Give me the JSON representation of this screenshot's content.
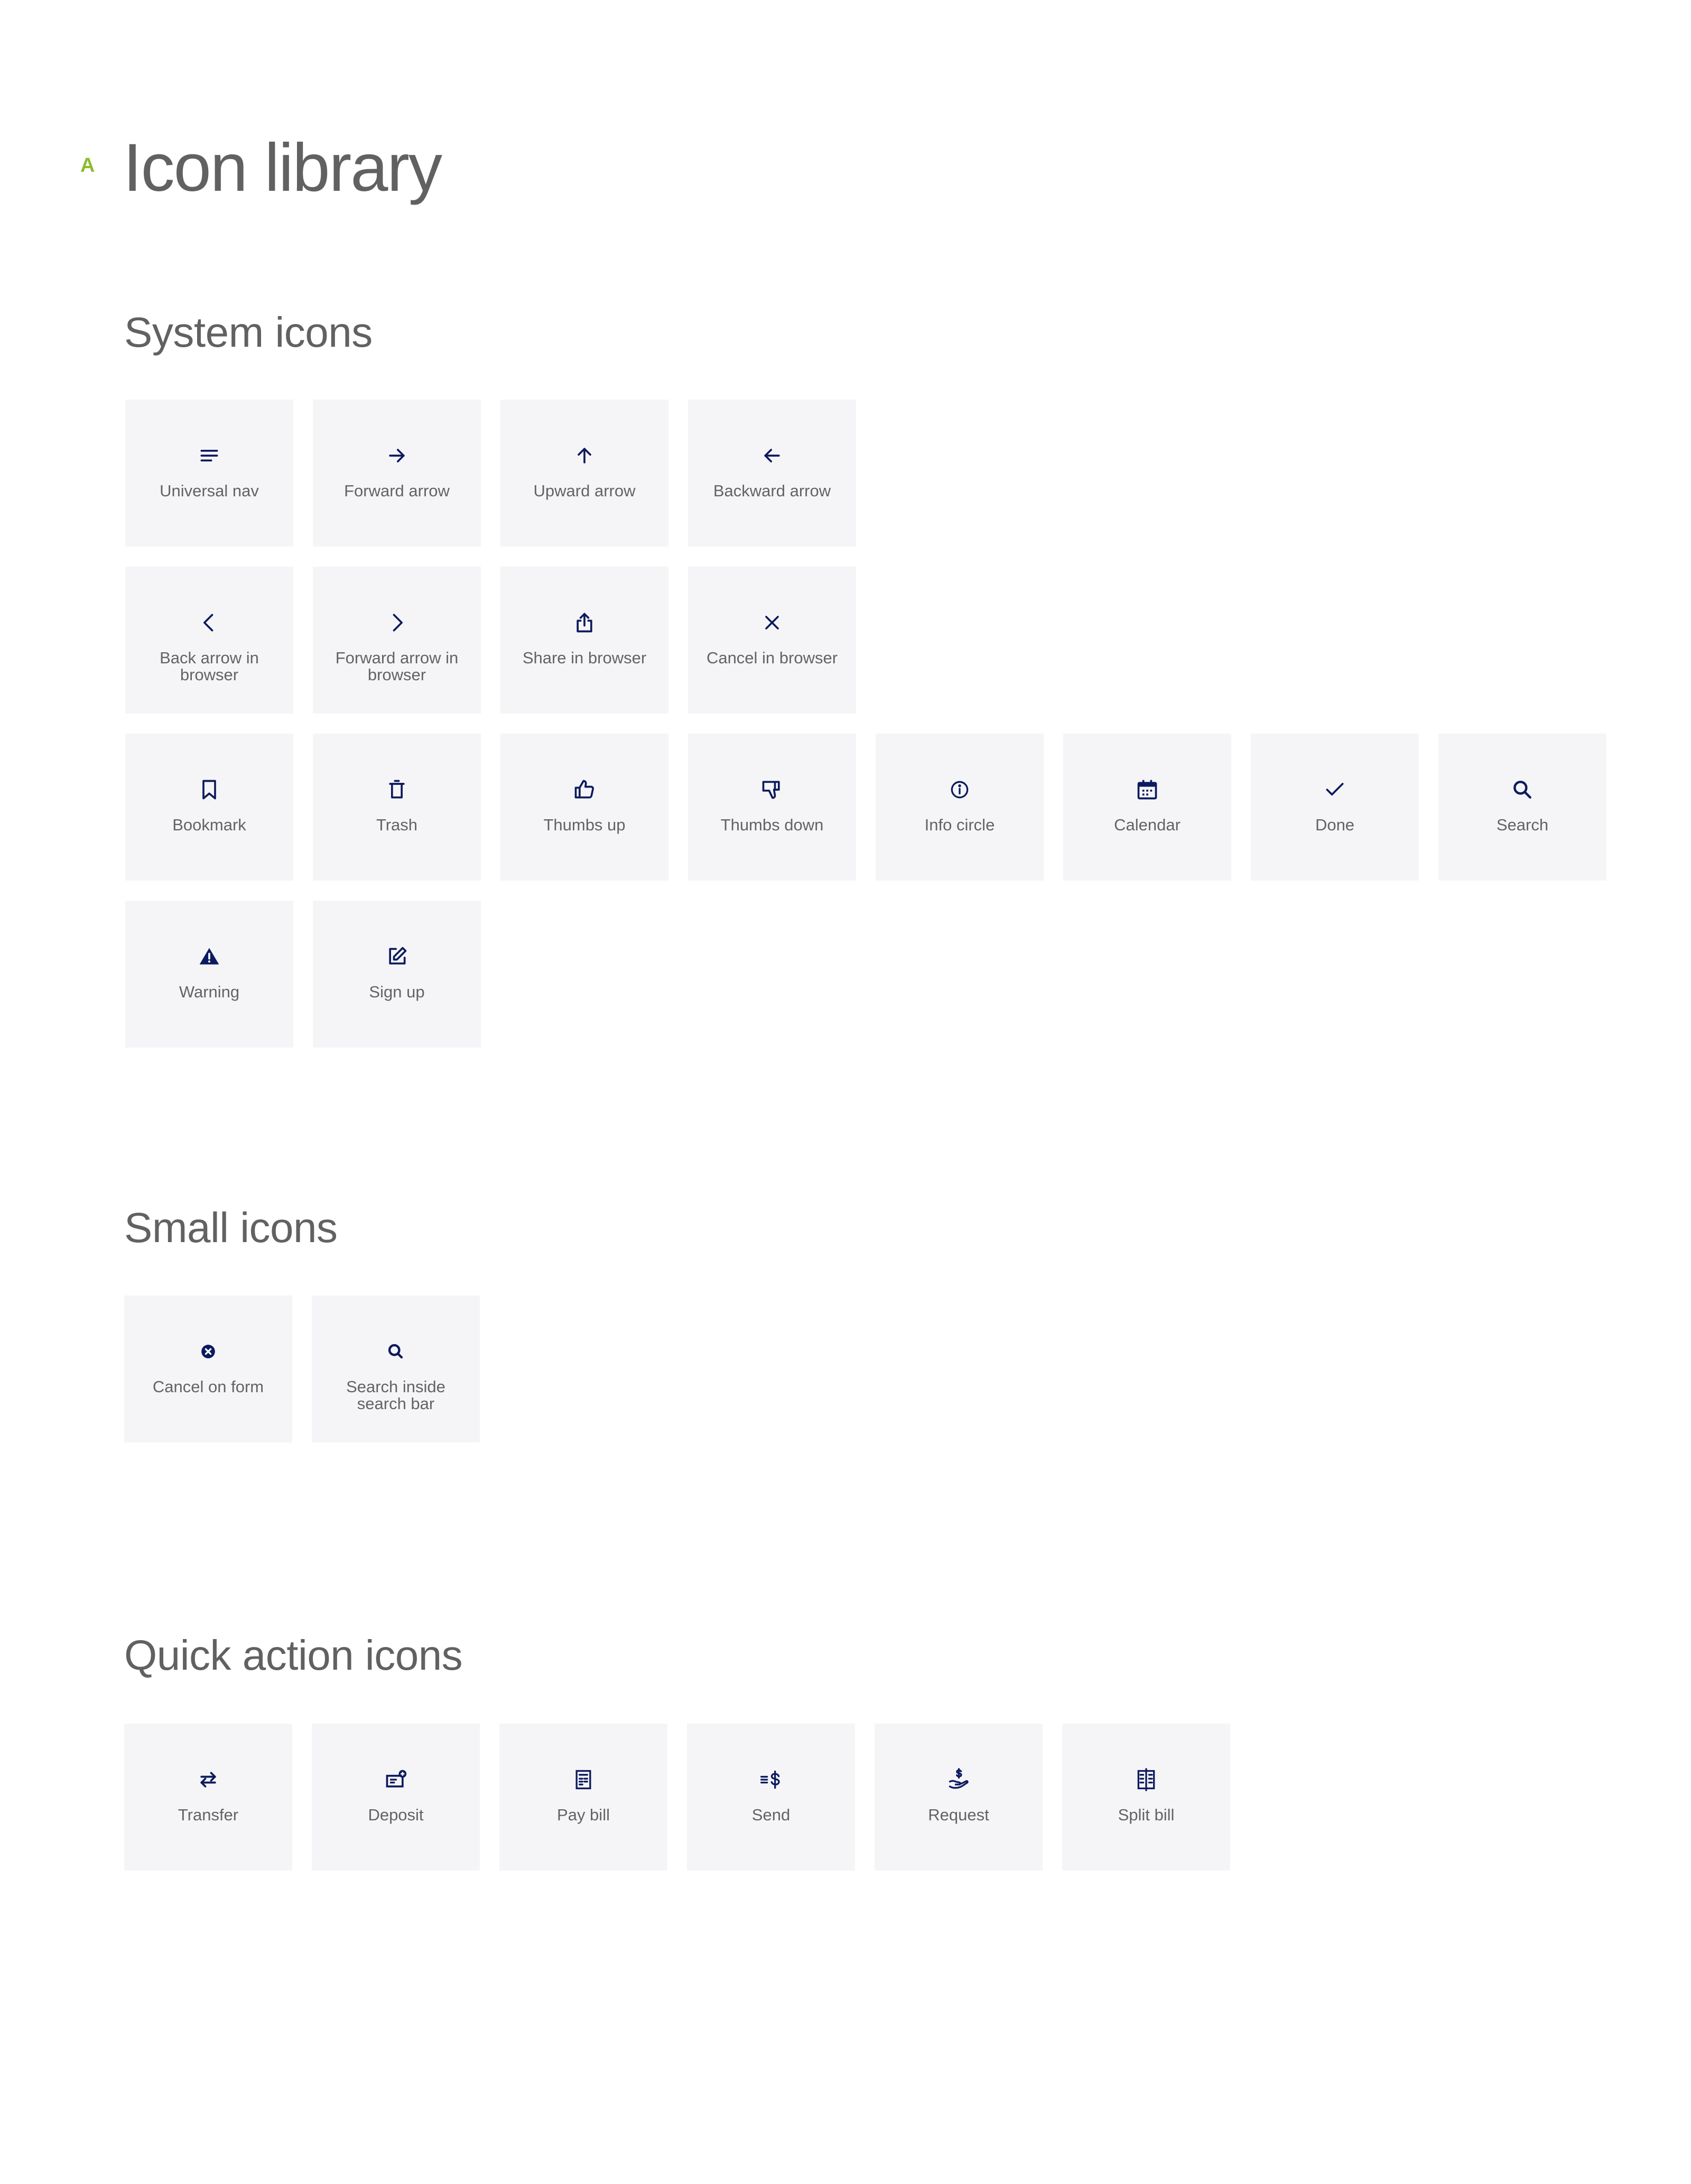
{
  "page": {
    "section_letter": "A",
    "title": "Icon library"
  },
  "colors": {
    "accent": "#8bbd2c",
    "icon": "#0c1a5e",
    "tile_bg": "#f5f5f7",
    "text": "#616161"
  },
  "system_icons": {
    "heading": "System icons",
    "items": [
      {
        "label": "Universal nav",
        "icon": "menu-icon"
      },
      {
        "label": "Forward arrow",
        "icon": "arrow-right-icon"
      },
      {
        "label": "Upward arrow",
        "icon": "arrow-up-icon"
      },
      {
        "label": "Backward arrow",
        "icon": "arrow-left-icon"
      },
      {
        "label": "Back arrow in browser",
        "icon": "chevron-left-icon"
      },
      {
        "label": "Forward arrow in browser",
        "icon": "chevron-right-icon"
      },
      {
        "label": "Share in browser",
        "icon": "share-icon"
      },
      {
        "label": "Cancel in browser",
        "icon": "close-icon"
      },
      {
        "label": "Bookmark",
        "icon": "bookmark-icon"
      },
      {
        "label": "Trash",
        "icon": "trash-icon"
      },
      {
        "label": "Thumbs up",
        "icon": "thumbs-up-icon"
      },
      {
        "label": "Thumbs down",
        "icon": "thumbs-down-icon"
      },
      {
        "label": "Info circle",
        "icon": "info-circle-icon"
      },
      {
        "label": "Calendar",
        "icon": "calendar-icon"
      },
      {
        "label": "Done",
        "icon": "check-icon"
      },
      {
        "label": "Search",
        "icon": "search-icon"
      },
      {
        "label": "Warning",
        "icon": "warning-icon"
      },
      {
        "label": "Sign up",
        "icon": "edit-icon"
      }
    ]
  },
  "small_icons": {
    "heading": "Small icons",
    "items": [
      {
        "label": "Cancel on form",
        "icon": "close-circle-filled-icon"
      },
      {
        "label": "Search inside search bar",
        "icon": "search-small-icon"
      }
    ]
  },
  "quick_action_icons": {
    "heading": "Quick action icons",
    "items": [
      {
        "label": "Transfer",
        "icon": "transfer-icon"
      },
      {
        "label": "Deposit",
        "icon": "deposit-check-icon"
      },
      {
        "label": "Pay bill",
        "icon": "bill-icon"
      },
      {
        "label": "Send",
        "icon": "send-money-icon"
      },
      {
        "label": "Request",
        "icon": "request-money-icon"
      },
      {
        "label": "Split bill",
        "icon": "split-bill-icon"
      }
    ]
  }
}
